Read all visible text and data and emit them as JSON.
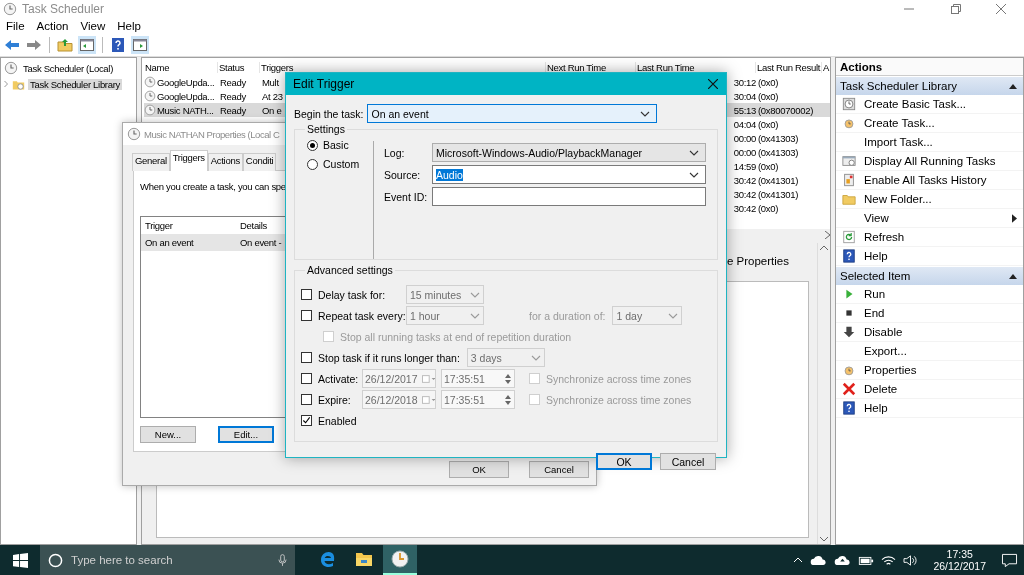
{
  "window": {
    "title": "Task Scheduler"
  },
  "menu": [
    "File",
    "Action",
    "View",
    "Help"
  ],
  "tree": [
    {
      "label": "Task Scheduler (Local)",
      "selected": false,
      "children": [
        {
          "label": "Task Scheduler Library",
          "selected": true,
          "expanded": false
        }
      ]
    }
  ],
  "tasks": {
    "columns": [
      "Name",
      "Status",
      "Triggers",
      "Next Run Time",
      "Last Run Time",
      "Last Run Result",
      "A"
    ],
    "rows": [
      {
        "name": "GoogleUpda...",
        "status": "Ready",
        "triggers": "Mult",
        "last_run_time": "30:12",
        "last_run_result": "(0x0)",
        "selected": false
      },
      {
        "name": "GoogleUpda...",
        "status": "Ready",
        "triggers": "At 23",
        "last_run_time": "30:04",
        "last_run_result": "(0x0)",
        "selected": false
      },
      {
        "name": "Music NATH...",
        "status": "Ready",
        "triggers": "On e",
        "last_run_time": "55:13",
        "last_run_result": "(0x80070002)",
        "selected": true
      },
      {
        "last_run_time": "04:04",
        "last_run_result": "(0x0)",
        "selected": false
      },
      {
        "last_run_time": "00:00",
        "last_run_result": "(0x41303)",
        "selected": false
      },
      {
        "last_run_time": "00:00",
        "last_run_result": "(0x41303)",
        "selected": false
      },
      {
        "last_run_time": "14:59",
        "last_run_result": "(0x0)",
        "selected": false
      },
      {
        "last_run_time": "30:42",
        "last_run_result": "(0x41301)",
        "selected": false
      },
      {
        "last_run_time": "30:42",
        "last_run_result": "(0x41301)",
        "selected": false
      },
      {
        "last_run_time": "30:42",
        "last_run_result": "(0x0)",
        "selected": false
      }
    ]
  },
  "lower_pane": {
    "heading": "e Properties"
  },
  "properties_dialog": {
    "title": "Music NATHAN Properties (Local C",
    "tabs": [
      {
        "label": "General",
        "selected": false
      },
      {
        "label": "Triggers",
        "selected": true
      },
      {
        "label": "Actions",
        "selected": false
      },
      {
        "label": "Conditi",
        "selected": false
      }
    ],
    "description": "When you create a task, you can spe",
    "columns": [
      "Trigger",
      "Details"
    ],
    "rows": [
      {
        "trigger": "On an event",
        "details": "On event -",
        "selected": true
      }
    ],
    "buttons": [
      {
        "label": "New...",
        "focused": false
      },
      {
        "label": "Edit...",
        "focused": true
      }
    ],
    "footer_buttons": [
      "OK",
      "Cancel"
    ]
  },
  "edit_trigger": {
    "title": "Edit Trigger",
    "begin_label": "Begin the task:",
    "begin_value": "On an event",
    "settings_label": "Settings",
    "modes": [
      {
        "label": "Basic",
        "selected": true
      },
      {
        "label": "Custom",
        "selected": false
      }
    ],
    "fields": [
      {
        "kind": "select",
        "label": "Log:",
        "value": "Microsoft-Windows-Audio/PlaybackManager"
      },
      {
        "kind": "combo",
        "label": "Source:",
        "value": "Audio",
        "highlighted": true
      },
      {
        "kind": "text",
        "label": "Event ID:"
      }
    ],
    "advanced_label": "Advanced settings",
    "advanced": [
      {
        "kind": "duration",
        "label": "Delay task for:",
        "checked": false,
        "disabled": false,
        "value": "15 minutes"
      },
      {
        "kind": "repeat",
        "label": "Repeat task every:",
        "checked": false,
        "disabled": false,
        "value": "1 hour",
        "extra_label": "for a duration of:",
        "extra_value": "1 day"
      },
      {
        "kind": "sub",
        "label": "Stop all running tasks at end of repetition duration",
        "checked": false,
        "disabled": true
      },
      {
        "kind": "limit",
        "label": "Stop task if it runs longer than:",
        "checked": false,
        "disabled": false,
        "value": "3 days"
      },
      {
        "kind": "date",
        "label": "Activate:",
        "checked": false,
        "disabled": false,
        "date": "26/12/2017",
        "time": "17:35:51",
        "sync_label": "Synchronize across time zones",
        "sync_checked": false
      },
      {
        "kind": "date",
        "label": "Expire:",
        "checked": false,
        "disabled": false,
        "date": "26/12/2018",
        "time": "17:35:51",
        "sync_label": "Synchronize across time zones",
        "sync_checked": false
      },
      {
        "kind": "plain",
        "label": "Enabled",
        "checked": true,
        "disabled": false
      }
    ],
    "buttons": [
      {
        "label": "OK",
        "default": true
      },
      {
        "label": "Cancel",
        "default": false
      }
    ]
  },
  "actions": {
    "title": "Actions",
    "sections": [
      {
        "title": "Task Scheduler Library",
        "expanded": true,
        "items": [
          {
            "label": "Create Basic Task...",
            "kind": "basic"
          },
          {
            "label": "Create Task...",
            "kind": "task"
          },
          {
            "label": "Import Task...",
            "kind": "none"
          },
          {
            "label": "Display All Running Tasks",
            "kind": "running"
          },
          {
            "label": "Enable All Tasks History",
            "kind": "history"
          },
          {
            "label": "New Folder...",
            "kind": "folder"
          },
          {
            "label": "View",
            "kind": "submenu"
          },
          {
            "label": "Refresh",
            "kind": "refresh"
          },
          {
            "label": "Help",
            "kind": "help"
          }
        ]
      },
      {
        "title": "Selected Item",
        "expanded": true,
        "items": [
          {
            "label": "Run",
            "kind": "run"
          },
          {
            "label": "End",
            "kind": "end"
          },
          {
            "label": "Disable",
            "kind": "disable"
          },
          {
            "label": "Export...",
            "kind": "none"
          },
          {
            "label": "Properties",
            "kind": "task"
          },
          {
            "label": "Delete",
            "kind": "delete"
          },
          {
            "label": "Help",
            "kind": "help"
          }
        ]
      }
    ]
  },
  "taskbar": {
    "search_placeholder": "Type here to search",
    "apps": [
      {
        "kind": "edge",
        "active": false
      },
      {
        "kind": "explorer",
        "active": false
      },
      {
        "kind": "scheduler",
        "active": true
      }
    ],
    "time": "17:35",
    "date": "26/12/2017"
  }
}
